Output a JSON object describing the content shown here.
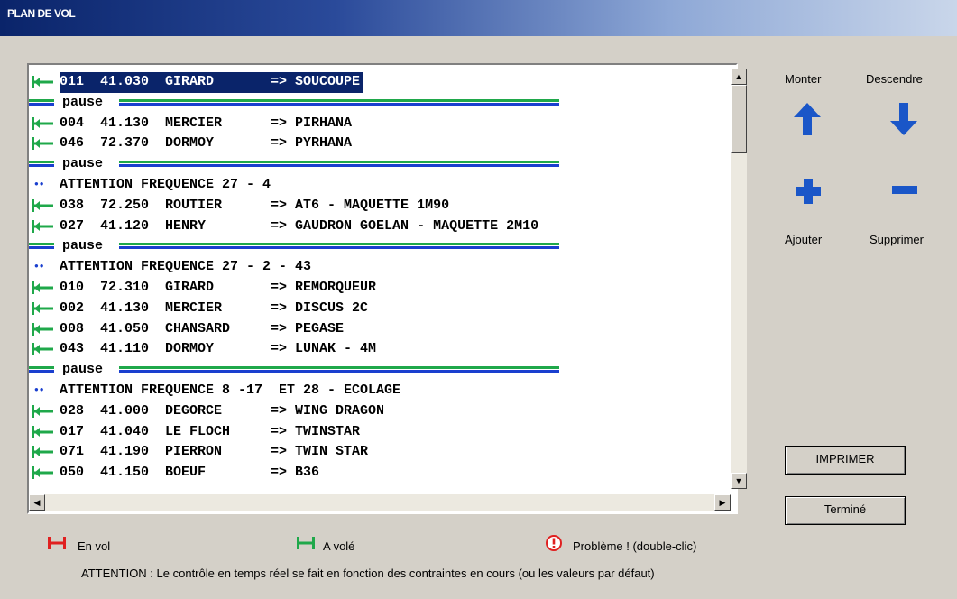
{
  "window": {
    "title": "PLAN DE VOL"
  },
  "list": {
    "rows": [
      {
        "kind": "flight",
        "status": "a-vole",
        "text": "011  41.030  GIRARD       => SOUCOUPE",
        "selected": true
      },
      {
        "kind": "pause",
        "text": "pause"
      },
      {
        "kind": "flight",
        "status": "a-vole",
        "text": "004  41.130  MERCIER      => PIRHANA"
      },
      {
        "kind": "flight",
        "status": "a-vole",
        "text": "046  72.370  DORMOY       => PYRHANA"
      },
      {
        "kind": "pause",
        "text": "pause"
      },
      {
        "kind": "attention",
        "text": "ATTENTION FREQUENCE 27 - 4"
      },
      {
        "kind": "flight",
        "status": "a-vole",
        "text": "038  72.250  ROUTIER      => AT6 - MAQUETTE 1M90"
      },
      {
        "kind": "flight",
        "status": "a-vole",
        "text": "027  41.120  HENRY        => GAUDRON GOELAN - MAQUETTE 2M10"
      },
      {
        "kind": "pause",
        "text": "pause"
      },
      {
        "kind": "attention",
        "text": "ATTENTION FREQUENCE 27 - 2 - 43"
      },
      {
        "kind": "flight",
        "status": "a-vole",
        "text": "010  72.310  GIRARD       => REMORQUEUR"
      },
      {
        "kind": "flight",
        "status": "a-vole",
        "text": "002  41.130  MERCIER      => DISCUS 2C"
      },
      {
        "kind": "flight",
        "status": "a-vole",
        "text": "008  41.050  CHANSARD     => PEGASE"
      },
      {
        "kind": "flight",
        "status": "a-vole",
        "text": "043  41.110  DORMOY       => LUNAK - 4M"
      },
      {
        "kind": "pause",
        "text": "pause"
      },
      {
        "kind": "attention",
        "text": "ATTENTION FREQUENCE 8 -17  ET 28 - ECOLAGE"
      },
      {
        "kind": "flight",
        "status": "a-vole",
        "text": "028  41.000  DEGORCE      => WING DRAGON"
      },
      {
        "kind": "flight",
        "status": "a-vole",
        "text": "017  41.040  LE FLOCH     => TWINSTAR"
      },
      {
        "kind": "flight",
        "status": "a-vole",
        "text": "071  41.190  PIERRON      => TWIN STAR"
      },
      {
        "kind": "flight",
        "status": "a-vole",
        "text": "050  41.150  BOEUF        => B36"
      }
    ]
  },
  "controls": {
    "monter": "Monter",
    "descendre": "Descendre",
    "ajouter": "Ajouter",
    "supprimer": "Supprimer",
    "imprimer": "IMPRIMER",
    "termine": "Terminé"
  },
  "legend": {
    "en_vol": "En vol",
    "a_vole": "A volé",
    "probleme": "Problème ! (double-clic)"
  },
  "note": "ATTENTION : Le contrôle en temps réel se fait en fonction des contraintes en cours (ou les valeurs par défaut)",
  "colors": {
    "selection": "#0a246a",
    "a_vole_icon": "#1fa84a",
    "en_vol_icon": "#e02020",
    "arrow_blue": "#1a56c8",
    "pause_green": "#1fa84a",
    "pause_blue": "#1a3fcf"
  }
}
